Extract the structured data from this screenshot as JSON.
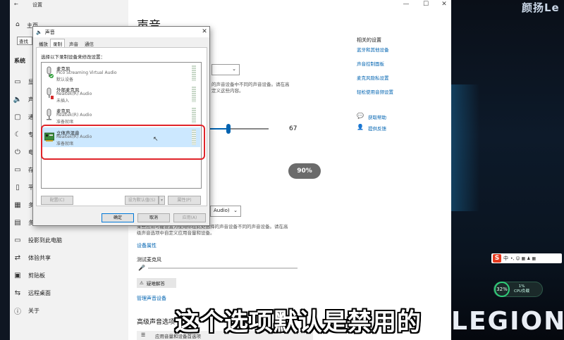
{
  "desktop": {
    "brand_top": "颜扬Le",
    "legion_logo": "LEGION"
  },
  "settings": {
    "title": "设置",
    "controls": {
      "minimize": "—",
      "maximize": "☐",
      "close": "✕"
    },
    "nav": {
      "home": "主页",
      "search_placeholder": "查找",
      "section": "系统",
      "items": [
        {
          "label": "显示",
          "icon": "monitor-icon"
        },
        {
          "label": "声音",
          "icon": "speaker-icon"
        },
        {
          "label": "通知",
          "icon": "notification-icon"
        },
        {
          "label": "专注",
          "icon": "moon-icon"
        },
        {
          "label": "电源",
          "icon": "power-icon"
        },
        {
          "label": "存储",
          "icon": "storage-icon"
        },
        {
          "label": "平板",
          "icon": "tablet-icon"
        },
        {
          "label": "多任务",
          "icon": "multitask-icon"
        },
        {
          "label": "投影到此电脑",
          "icon": "project-icon"
        },
        {
          "label": "体验共享",
          "icon": "share-icon"
        },
        {
          "label": "剪贴板",
          "icon": "clipboard-icon"
        },
        {
          "label": "远程桌面",
          "icon": "remote-icon"
        },
        {
          "label": "关于",
          "icon": "info-icon"
        }
      ]
    },
    "main": {
      "title": "声音",
      "output_desc_1": "的声音设备中不同的声音设备。请在高",
      "output_desc_2": "定义这些内容。",
      "volume_value": "67",
      "volume_bubble": "90%",
      "input_dropdown": "Audio)",
      "input_desc_1": "某些应用可能设置为使用你在此处选择的声音设备不同的声音设备。请在高",
      "input_desc_2": "级声音选项中自定义应用音量和设备。",
      "device_properties": "设备属性",
      "test_mic": "测试麦克风",
      "troubleshoot": "疑难解答",
      "manage_devices": "管理声音设备",
      "advanced_title": "高级声音选项",
      "advanced_item": "应用音量和设备首选项"
    },
    "related": {
      "title": "相关的设置",
      "links": [
        "蓝牙和其他设备",
        "声音控制面板",
        "麦克风隐私设置",
        "轻松使用音频设置"
      ],
      "help": "获取帮助",
      "feedback": "提供反馈"
    }
  },
  "dialog": {
    "title": "声音",
    "close": "✕",
    "tabs": [
      "播放",
      "录制",
      "声音",
      "通信"
    ],
    "active_tab": 1,
    "instruction": "选择以下录制设备来修改设置：",
    "devices": [
      {
        "name": "麦克风",
        "driver": "Pico Streaming Virtual Audio",
        "status": "默认设备",
        "badge": "default"
      },
      {
        "name": "外部麦克风",
        "driver": "Realtek(R) Audio",
        "status": "未插入",
        "badge": "unplugged"
      },
      {
        "name": "麦克风",
        "driver": "Realtek(R) Audio",
        "status": "准备就绪",
        "badge": "none"
      },
      {
        "name": "立体声混音",
        "driver": "Realtek(R) Audio",
        "status": "准备就绪",
        "badge": "none"
      }
    ],
    "buttons": {
      "configure": "配置(C)",
      "set_default": "设为默认值(S)",
      "properties": "属性(P)",
      "ok": "确定",
      "cancel": "取消",
      "apply": "应用(A)"
    }
  },
  "subtitle": "这个选项默认是禁用的",
  "ime": {
    "label": "中",
    "symbols": "•, ☺ ▦ ♟ ▦"
  },
  "cpu_widget": {
    "percent": "32%",
    "label_1": "1%",
    "label_2": "CPU负载"
  }
}
